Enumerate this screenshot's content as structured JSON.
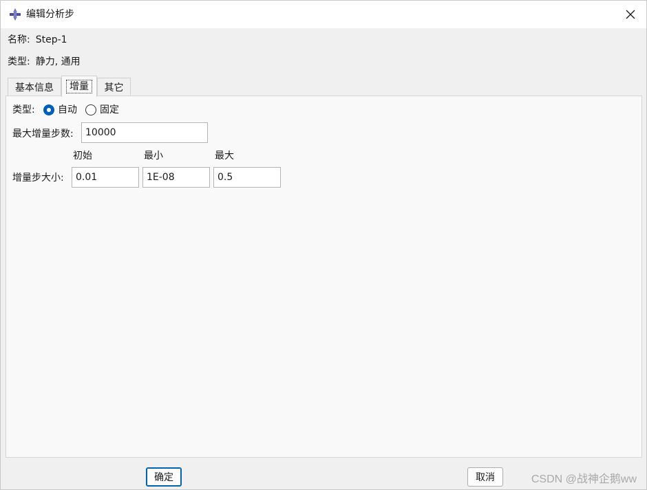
{
  "window": {
    "title": "编辑分析步",
    "close_glyph": "✕"
  },
  "fields": {
    "name_label": "名称:",
    "name_value": "Step-1",
    "type_label": "类型:",
    "type_value": "静力, 通用"
  },
  "tabs": [
    {
      "label": "基本信息",
      "active": false
    },
    {
      "label": "增量",
      "active": true
    },
    {
      "label": "其它",
      "active": false
    }
  ],
  "increment": {
    "type_label": "类型:",
    "type_options": [
      {
        "label": "自动",
        "checked": true
      },
      {
        "label": "固定",
        "checked": false
      }
    ],
    "max_steps_label": "最大增量步数:",
    "max_steps_value": "10000",
    "size_label": "增量步大小:",
    "columns": [
      "初始",
      "最小",
      "最大"
    ],
    "values": [
      "0.01",
      "1E-08",
      "0.5"
    ]
  },
  "buttons": {
    "ok_label": "确定",
    "cancel_label": "取消"
  },
  "watermark": "CSDN @战神企鹅ww",
  "colors": {
    "accent": "#005fb8",
    "background": "#f0f0f0",
    "panel": "#f9f9f9"
  }
}
